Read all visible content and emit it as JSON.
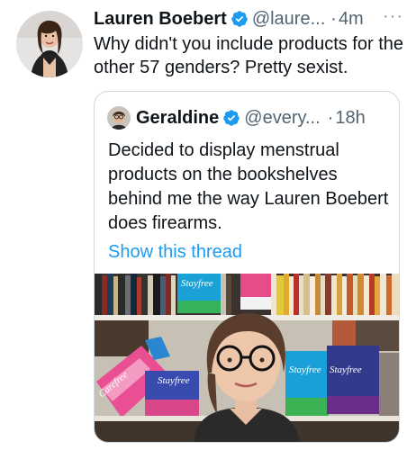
{
  "tweet": {
    "display_name": "Lauren Boebert",
    "handle": "@laure...",
    "separator": "·",
    "time": "4m",
    "more": "···",
    "text": "Why didn't you include products for the other 57 genders? Pretty sexist.",
    "avatar_icon": "profile-photo-icon"
  },
  "quote": {
    "display_name": "Geraldine",
    "handle": "@every...",
    "separator": "·",
    "time": "18h",
    "text": "Decided to display menstrual products on the bookshelves behind me the way Lauren Boebert does firearms.",
    "show_thread": "Show this thread",
    "media": {
      "brand_labels": [
        "Stayfree",
        "Carefree",
        "Stayfree",
        "Stayfree",
        "Stayfree"
      ]
    }
  },
  "colors": {
    "verified": "#1d9bf0",
    "link": "#1d9bf0",
    "secondary_text": "#536471",
    "border": "#cfd9de"
  }
}
